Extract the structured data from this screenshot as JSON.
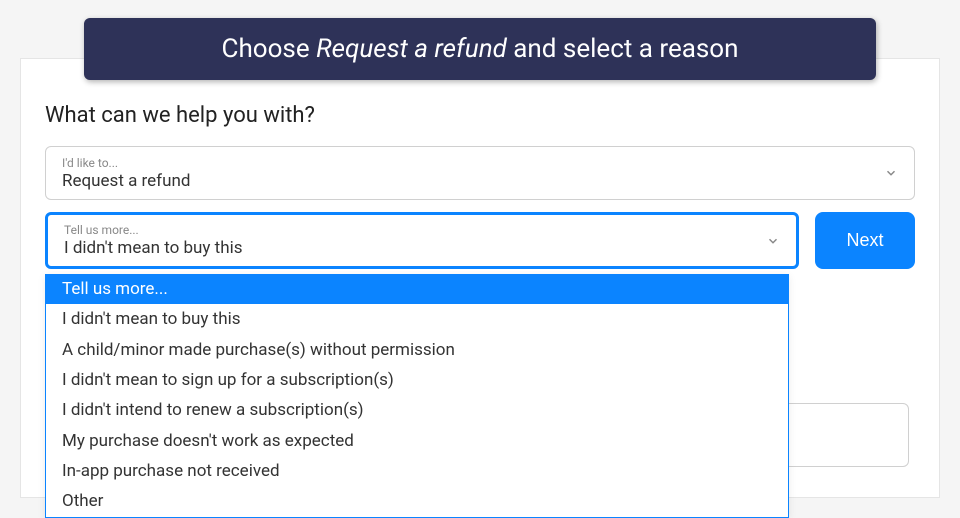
{
  "banner": {
    "prefix": "Choose ",
    "italic": "Request a refund",
    "suffix": " and select a reason"
  },
  "form": {
    "question": "What can we help you with?",
    "select1": {
      "label": "I'd like to...",
      "value": "Request a refund"
    },
    "select2": {
      "label": "Tell us more...",
      "value": "I didn't mean to buy this"
    },
    "next_label": "Next"
  },
  "dropdown": {
    "options": [
      "Tell us more...",
      "I didn't mean to buy this",
      "A child/minor made purchase(s) without permission",
      "I didn't mean to sign up for a subscription(s)",
      "I didn't intend to renew a subscription(s)",
      "My purchase doesn't work as expected",
      "In-app purchase not received",
      "Other"
    ],
    "highlighted_index": 0
  }
}
